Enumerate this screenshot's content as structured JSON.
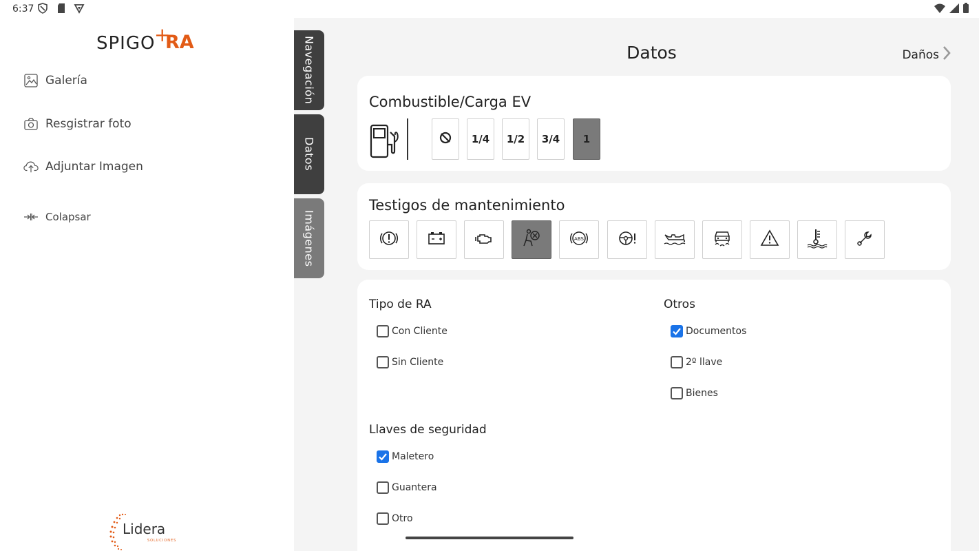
{
  "status_bar": {
    "time": "6:37",
    "icons": [
      "shield-icon",
      "sd-card-icon",
      "vpn-icon",
      "wifi-icon",
      "signal-icon",
      "battery-icon"
    ]
  },
  "sidebar": {
    "logo_text": "SPIGO",
    "logo_plus": "+",
    "logo_suffix": "RA",
    "items": [
      {
        "label": "Galería",
        "icon": "gallery-icon"
      },
      {
        "label": "Resgistrar foto",
        "icon": "camera-icon"
      },
      {
        "label": "Adjuntar Imagen",
        "icon": "cloud-upload-icon"
      },
      {
        "label": "Colapsar",
        "icon": "collapse-icon"
      }
    ],
    "footer_logo": "Lidera",
    "footer_logo_sub": "SOLUCIONES"
  },
  "tabs": [
    {
      "label": "Navegación",
      "active": false
    },
    {
      "label": "Datos",
      "active": true
    },
    {
      "label": "Imágenes",
      "active": false
    }
  ],
  "header": {
    "title": "Datos",
    "next_label": "Daños"
  },
  "fuel": {
    "title": "Combustible/Carga EV",
    "options": [
      "⊘",
      "1/4",
      "1/2",
      "3/4",
      "1"
    ],
    "selected": "1"
  },
  "maintenance": {
    "title": "Testigos de mantenimiento",
    "icons": [
      "brake-warning-icon",
      "battery-warning-icon",
      "engine-warning-icon",
      "airbag-warning-icon",
      "abs-warning-icon",
      "steering-warning-icon",
      "oil-pressure-icon",
      "traction-control-icon",
      "hazard-warning-icon",
      "coolant-temp-icon",
      "service-wrench-icon"
    ],
    "selected": "airbag-warning-icon"
  },
  "tipo_ra": {
    "title": "Tipo de RA",
    "options": [
      {
        "label": "Con Cliente",
        "checked": false
      },
      {
        "label": "Sin Cliente",
        "checked": false
      }
    ]
  },
  "otros": {
    "title": "Otros",
    "options": [
      {
        "label": "Documentos",
        "checked": true
      },
      {
        "label": "2º llave",
        "checked": false
      },
      {
        "label": "Bienes",
        "checked": false
      }
    ]
  },
  "llaves": {
    "title": "Llaves de seguridad",
    "options": [
      {
        "label": "Maletero",
        "checked": true
      },
      {
        "label": "Guantera",
        "checked": false
      },
      {
        "label": "Otro",
        "checked": false
      }
    ]
  },
  "colors": {
    "accent": "#e25b16",
    "checkbox": "#1a73e8",
    "tab_dark": "#3f3f3f",
    "tab_grey": "#7a7a7a"
  }
}
